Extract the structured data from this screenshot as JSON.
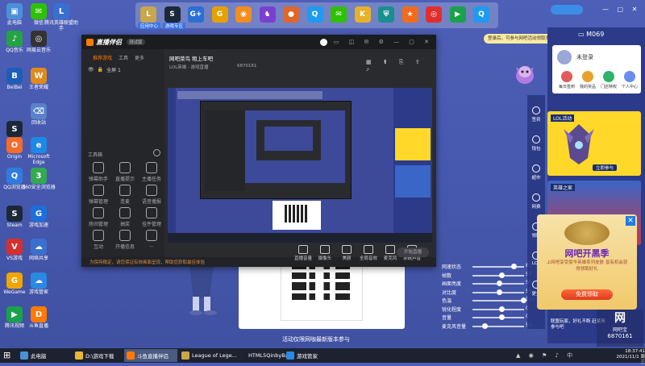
{
  "desktop_icons": [
    {
      "label": "此电脑",
      "color": "#4a90d9",
      "glyph": "▣"
    },
    {
      "label": "微信",
      "color": "#2dc100",
      "glyph": "✉"
    },
    {
      "label": "腾讯英雄联盟助手",
      "color": "#3a6fcf",
      "glyph": "L"
    },
    {
      "label": "QQ音乐",
      "color": "#25a244",
      "glyph": "♪"
    },
    {
      "label": "网易云音乐",
      "color": "#333333",
      "glyph": "◎"
    },
    {
      "label": "BeiBei",
      "color": "#1d5eb8",
      "glyph": "B"
    },
    {
      "label": "王者荣耀",
      "color": "#e08a1e",
      "glyph": "W"
    },
    {
      "label": "回收站",
      "color": "#5a82c8",
      "glyph": "⌫"
    },
    {
      "label": "Steam",
      "color": "#1b2838",
      "glyph": "S"
    },
    {
      "label": "Origin",
      "color": "#f56c2d",
      "glyph": "O"
    },
    {
      "label": "Microsoft Edge",
      "color": "#1e88e5",
      "glyph": "e"
    },
    {
      "label": "QQ浏览器",
      "color": "#2f7ce0",
      "glyph": "Q"
    },
    {
      "label": "360安全浏览器",
      "color": "#35a852",
      "glyph": "3"
    },
    {
      "label": "Steam",
      "color": "#1b2838",
      "glyph": "S"
    },
    {
      "label": "游戏加速",
      "color": "#1e6fd9",
      "glyph": "G"
    },
    {
      "label": "VS游戏",
      "color": "#d62f2f",
      "glyph": "V"
    },
    {
      "label": "网络共享",
      "color": "#3a6fcf",
      "glyph": "☁"
    },
    {
      "label": "WeGame",
      "color": "#f0a500",
      "glyph": "G"
    },
    {
      "label": "游戏管家",
      "color": "#2b89e3",
      "glyph": "☁"
    },
    {
      "label": "腾讯视频",
      "color": "#1aa14b",
      "glyph": "▶"
    },
    {
      "label": "斗鱼直播",
      "color": "#ff7a00",
      "glyph": "D"
    }
  ],
  "top_toolbar": {
    "tab1": "应用中心",
    "tab2": "游戏专区",
    "apps": [
      {
        "name": "lol-icon",
        "color": "#c8a64b",
        "glyph": "L"
      },
      {
        "name": "steam-icon",
        "color": "#1b2838",
        "glyph": "S"
      },
      {
        "name": "gplus-icon",
        "color": "#2a6fd6",
        "glyph": "G+"
      },
      {
        "name": "wegame-icon",
        "color": "#e5a100",
        "glyph": "G"
      },
      {
        "name": "overwatch-icon",
        "color": "#f28d1e",
        "glyph": "◉"
      },
      {
        "name": "game-icon",
        "color": "#7b3fcf",
        "glyph": "♞"
      },
      {
        "name": "basketball-icon",
        "color": "#e0662a",
        "glyph": "●"
      },
      {
        "name": "qq-icon",
        "color": "#1e9bf0",
        "glyph": "Q"
      },
      {
        "name": "wechat-icon",
        "color": "#2dc100",
        "glyph": "✉"
      },
      {
        "name": "kugou-icon",
        "color": "#e6b12b",
        "glyph": "K"
      },
      {
        "name": "shield-icon",
        "color": "#1a8f8f",
        "glyph": "⛨"
      },
      {
        "name": "game-center-icon",
        "color": "#f26b1d",
        "glyph": "★"
      },
      {
        "name": "netease-icon",
        "color": "#e22d2d",
        "glyph": "◎"
      },
      {
        "name": "video-icon",
        "color": "#1aa14b",
        "glyph": "▶"
      },
      {
        "name": "qqgame-icon",
        "color": "#1e9bf0",
        "glyph": "Q"
      }
    ]
  },
  "window": {
    "brand": "直播伴侣",
    "badge": "测试版",
    "sidebar_tabs": [
      "推荐游戏",
      "工具",
      "更多"
    ],
    "scene": "全屏 1",
    "tools_title": "工具箱",
    "tools": [
      "弹幕助手",
      "直播提示",
      "主播任务",
      "弹幕管理",
      "连麦",
      "语音播报",
      "房间管理",
      "抽奖",
      "挂件管理",
      "互动",
      "开播信息",
      "..."
    ],
    "bottom_tip": "为保持稳定，请您保证有效画面呈现，帮助您获取最佳体验",
    "stream_title": "网吧菜鸟 租上车吧",
    "stream_sub": "LOL英雄 · 游戏直播",
    "room_id": "6870161",
    "controls": [
      "直播音量",
      "摄像头",
      "美颜",
      "全局音效",
      "麦克风",
      "系统声音"
    ],
    "start_button": "开始直播"
  },
  "notice_bubble": "登录后，可参与网吧活动领取奖励哦",
  "right_panel": {
    "machine": "M069",
    "user": "未登录",
    "quick": [
      "每日签到",
      "我的奖品",
      "门店特权",
      "个人中心"
    ],
    "quick_colors": [
      "#e35a5a",
      "#e8a22b",
      "#2fb36b",
      "#6a8df0"
    ],
    "side_nav": [
      "签到",
      "钱包",
      "超市",
      "网费",
      "领取",
      "LOL",
      "更多"
    ],
    "banner1_tag": "LOL活动",
    "banner1_cta": "立即参与",
    "banner2_tag": "英雄之家",
    "popup_title": "网吧开黑季",
    "popup_text": "上网吧享受豪华英雄系列皮肤 皆有机会获得领取好礼",
    "popup_button": "免费领取",
    "bottom_text": "联盟玩家，好礼不断 赶紧来参与吧",
    "code": "6870161",
    "cafe_name": "网吧宝"
  },
  "sliders": [
    {
      "label": "网速状态",
      "value": "80",
      "level": 0.8
    },
    {
      "label": "帧数",
      "value": "50",
      "level": 0.55
    },
    {
      "label": "画面亮度",
      "value": "50",
      "level": 0.5
    },
    {
      "label": "对比度",
      "value": "50",
      "level": 0.5
    },
    {
      "label": "色温",
      "value": "100",
      "level": 1.0
    },
    {
      "label": "锐化程度",
      "value": "0",
      "level": 0.55
    },
    {
      "label": "音量",
      "value": "0",
      "level": 0.55
    },
    {
      "label": "麦克风音量",
      "value": "50",
      "level": 0.2
    }
  ],
  "activity_text": "活动仅限网咖最新版本参与",
  "taskbar": {
    "start": "⊞",
    "items": [
      {
        "label": "此电脑",
        "color": "#4a90d9"
      },
      {
        "label": "D:\\游戏下载",
        "color": "#e8b830"
      },
      {
        "label": "斗鱼直播伴侣",
        "color": "#ff7a00"
      },
      {
        "label": "League of Lege...",
        "color": "#c8a64b"
      },
      {
        "label": "HTML5QinbyBal...",
        "color": "#4a90d9"
      },
      {
        "label": "游戏管家",
        "color": "#2b89e3"
      }
    ],
    "time": "18:37:41",
    "date": "2021/11/1 周三"
  }
}
